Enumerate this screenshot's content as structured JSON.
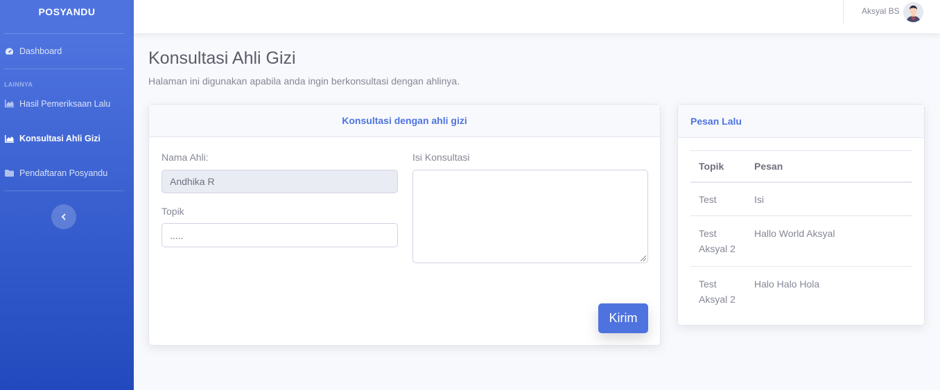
{
  "sidebar": {
    "brand": "POSYANDU",
    "dashboard": "Dashboard",
    "section_heading": "LAINNYA",
    "items": [
      {
        "label": "Hasil Pemeriksaan Lalu",
        "icon": "chart-area-icon"
      },
      {
        "label": "Konsultasi Ahli Gizi",
        "icon": "chart-area-icon",
        "active": true
      },
      {
        "label": "Pendaftaran Posyandu",
        "icon": "folder-icon"
      }
    ],
    "toggle_icon": "chevron-left-icon"
  },
  "topbar": {
    "user_name": "Aksyal BS",
    "avatar_icon": "user-avatar"
  },
  "page": {
    "title": "Konsultasi Ahli Gizi",
    "description": "Halaman ini digunakan apabila anda ingin berkonsultasi dengan ahlinya."
  },
  "form": {
    "header": "Konsultasi dengan ahli gizi",
    "nama_label": "Nama Ahli:",
    "nama_value": "Andhika R",
    "topik_label": "Topik",
    "topik_placeholder": ".....",
    "isi_label": "Isi Konsultasi",
    "submit": "Kirim"
  },
  "history": {
    "header": "Pesan Lalu",
    "columns": [
      "Topik",
      "Pesan"
    ],
    "rows": [
      {
        "topik": "Test",
        "pesan": "Isi"
      },
      {
        "topik": "Test Aksyal 2",
        "pesan": "Hallo World Aksyal"
      },
      {
        "topik": "Test Aksyal 2",
        "pesan": "Halo Halo Hola"
      }
    ]
  },
  "colors": {
    "primary": "#4e73df",
    "sidebar_gradient_end": "#224abe",
    "background": "#f8f9fc"
  }
}
